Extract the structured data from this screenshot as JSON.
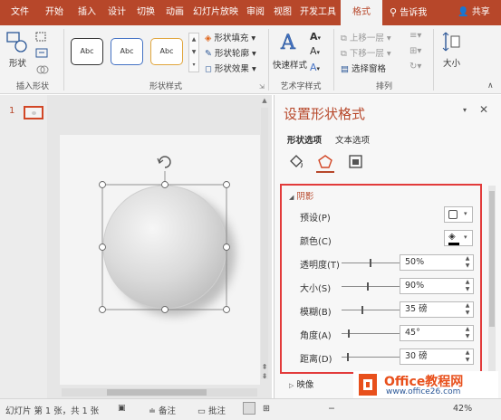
{
  "ribbon_tabs": [
    "文件",
    "开始",
    "插入",
    "设计",
    "切换",
    "动画",
    "幻灯片放映",
    "审阅",
    "视图",
    "开发工具",
    "格式"
  ],
  "active_tab": "格式",
  "tell_me": "告诉我",
  "share": "共享",
  "groups": {
    "insert_shapes": {
      "label": "插入形状",
      "shape_btn": "形状"
    },
    "shape_styles": {
      "label": "形状样式",
      "style_boxes": [
        "Abc",
        "Abc",
        "Abc"
      ],
      "fill": "形状填充",
      "outline": "形状轮廓",
      "effects": "形状效果"
    },
    "wordart": {
      "label": "艺术字样式",
      "quick": "快速样式"
    },
    "arrange": {
      "label": "排列",
      "bring_forward": "上移一层",
      "send_backward": "下移一层",
      "selection_pane": "选择窗格"
    },
    "size": {
      "label": "大小"
    }
  },
  "thumb": {
    "number": "1"
  },
  "format_pane": {
    "title": "设置形状格式",
    "tabs": [
      "形状选项",
      "文本选项"
    ],
    "shadow_section": "阴影",
    "reflection_section": "映像",
    "rows": [
      {
        "label": "预设(P)"
      },
      {
        "label": "颜色(C)"
      },
      {
        "label": "透明度(T)",
        "value": "50%",
        "level": 0.5
      },
      {
        "label": "大小(S)",
        "value": "90%",
        "level": 0.45
      },
      {
        "label": "模糊(B)",
        "value": "35 磅",
        "level": 0.35
      },
      {
        "label": "角度(A)",
        "value": "45°",
        "level": 0.12
      },
      {
        "label": "距离(D)",
        "value": "30 磅",
        "level": 0.1
      }
    ]
  },
  "status": {
    "slide_info": "幻灯片 第 1 张，共 1 张",
    "notes": "备注",
    "comments": "批注",
    "zoom": "42%"
  },
  "watermark": {
    "brand": "Office教程网",
    "url": "www.office26.com"
  },
  "colors": {
    "accent": "#b7472a",
    "highlight_border": "#e23b3b"
  }
}
